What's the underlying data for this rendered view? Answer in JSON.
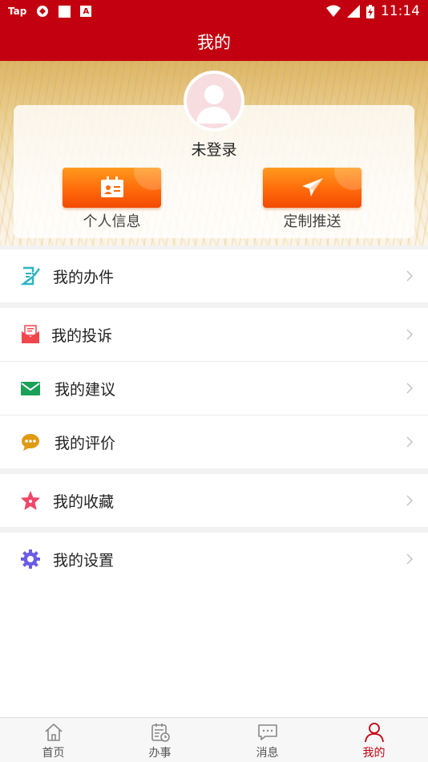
{
  "status_bar": {
    "tap_text": "Tap",
    "time": "11:14",
    "a_glyph": "A"
  },
  "header": {
    "title": "我的"
  },
  "profile": {
    "avatar_icon": "user-avatar-icon",
    "login_status": "未登录"
  },
  "actions": [
    {
      "label": "个人信息",
      "icon": "id-card-icon"
    },
    {
      "label": "定制推送",
      "icon": "paper-plane-icon"
    }
  ],
  "menu": [
    {
      "label": "我的办件",
      "icon": "document-check-icon",
      "color": "#2bb5c4"
    },
    {
      "label": "我的投诉",
      "icon": "envelope-open-icon",
      "color": "#f0474d"
    },
    {
      "label": "我的建议",
      "icon": "envelope-icon",
      "color": "#1aa058"
    },
    {
      "label": "我的评价",
      "icon": "chat-bubble-icon",
      "color": "#e09a12"
    },
    {
      "label": "我的收藏",
      "icon": "star-icon",
      "color": "#f0476a"
    },
    {
      "label": "我的设置",
      "icon": "gear-icon",
      "color": "#6b5ce6"
    }
  ],
  "tabs": [
    {
      "label": "首页",
      "icon": "home-icon",
      "active": false
    },
    {
      "label": "办事",
      "icon": "calendar-clock-icon",
      "active": false
    },
    {
      "label": "消息",
      "icon": "message-icon",
      "active": false
    },
    {
      "label": "我的",
      "icon": "person-icon",
      "active": true
    }
  ],
  "colors": {
    "brand": "#c3000f",
    "button_orange": "#ff6a0a",
    "active_tab": "#c3000f"
  }
}
